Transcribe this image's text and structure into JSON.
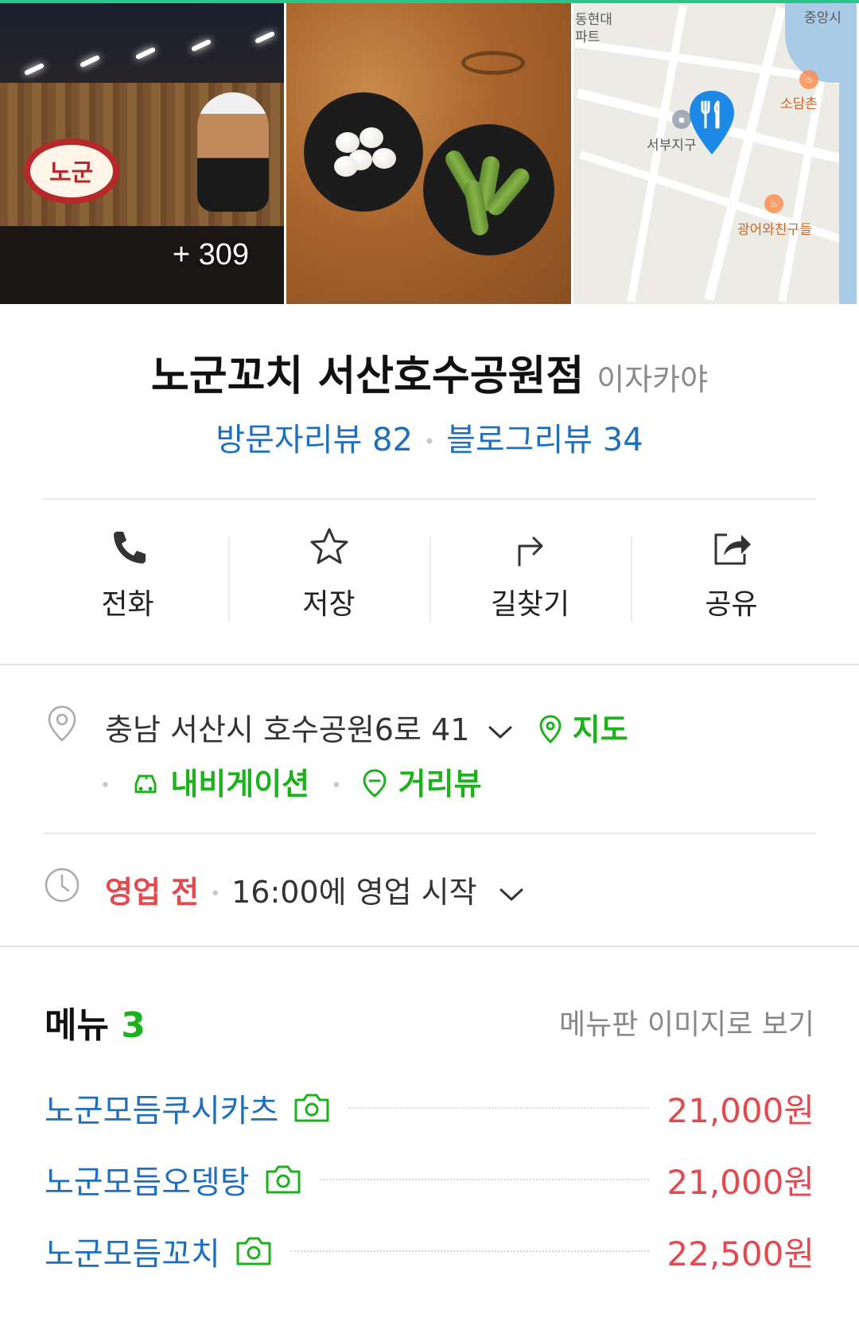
{
  "photos": {
    "count_label": "+ 309",
    "store_sign_text": "노군",
    "map_labels": [
      "동현대",
      "파트",
      "서부지구",
      "소담촌",
      "광어와친구들",
      "중앙시"
    ]
  },
  "place": {
    "name": "노군꼬치 서산호수공원점",
    "category": "이자카야",
    "visitor_review": "방문자리뷰 82",
    "blog_review": "블로그리뷰 34"
  },
  "actions": [
    {
      "label": "전화",
      "icon": "phone-icon"
    },
    {
      "label": "저장",
      "icon": "star-icon"
    },
    {
      "label": "길찾기",
      "icon": "directions-icon"
    },
    {
      "label": "공유",
      "icon": "share-icon"
    }
  ],
  "address": {
    "text": "충남 서산시 호수공원6로 41",
    "map_link": "지도",
    "navigation_link": "내비게이션",
    "streetview_link": "거리뷰"
  },
  "hours": {
    "status": "영업 전",
    "detail": "16:00에 영업 시작"
  },
  "menu": {
    "title": "메뉴",
    "count": "3",
    "board_link": "메뉴판 이미지로 보기",
    "items": [
      {
        "name": "노군모듬쿠시카츠",
        "price": "21,000원"
      },
      {
        "name": "노군모듬오뎅탕",
        "price": "21,000원"
      },
      {
        "name": "노군모듬꼬치",
        "price": "22,500원"
      }
    ]
  },
  "colors": {
    "link_blue": "#1f6fbf",
    "green": "#1db21d",
    "price_red": "#e5484d",
    "top_accent": "#2bc58a"
  }
}
